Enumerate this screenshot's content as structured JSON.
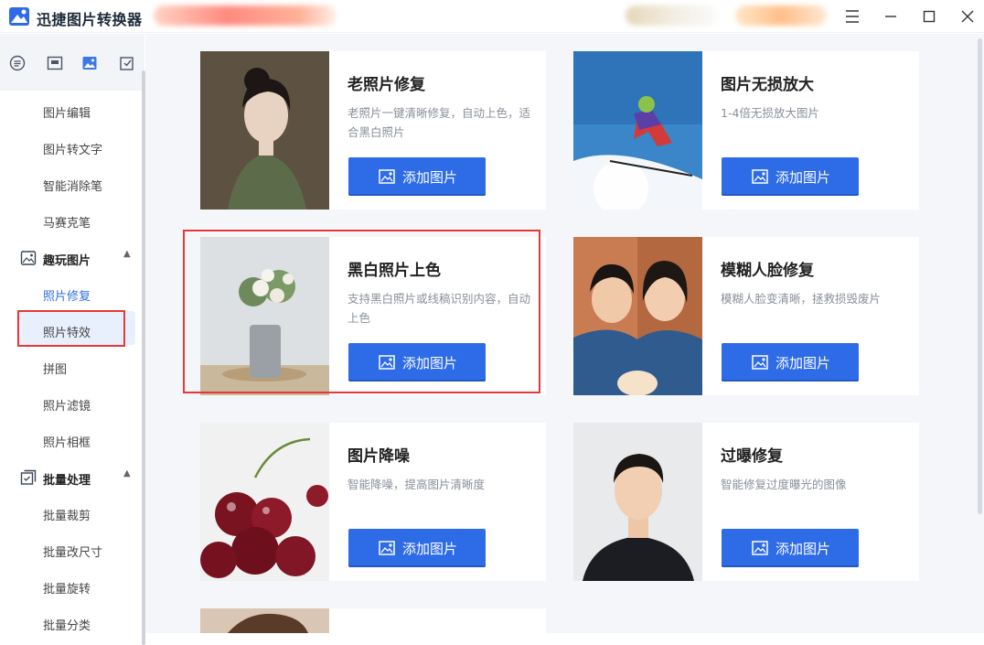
{
  "app": {
    "title": "迅捷图片转换器"
  },
  "sidebar": {
    "tool_icons": [
      "document-icon",
      "image-frame-icon",
      "picture-icon",
      "crop-icon"
    ],
    "items": [
      {
        "label": "图片编辑"
      },
      {
        "label": "图片转文字"
      },
      {
        "label": "智能消除笔"
      },
      {
        "label": "马赛克笔"
      }
    ],
    "group_fun": {
      "label": "趣玩图片",
      "icon": "image-fun-icon"
    },
    "fun_items": [
      {
        "label": "照片修复",
        "active": true
      },
      {
        "label": "照片特效"
      },
      {
        "label": "拼图"
      },
      {
        "label": "照片滤镜"
      },
      {
        "label": "照片相框"
      }
    ],
    "group_batch": {
      "label": "批量处理",
      "icon": "batch-icon"
    },
    "batch_items": [
      {
        "label": "批量裁剪"
      },
      {
        "label": "批量改尺寸"
      },
      {
        "label": "批量旋转"
      },
      {
        "label": "批量分类"
      }
    ]
  },
  "cards": [
    {
      "title": "老照片修复",
      "desc": "老照片一键清晰修复，自动上色，适合黑白照片",
      "button": "添加图片"
    },
    {
      "title": "图片无损放大",
      "desc": "1-4倍无损放大图片",
      "button": "添加图片"
    },
    {
      "title": "黑白照片上色",
      "desc": "支持黑白照片或线稿识别内容，自动上色",
      "button": "添加图片"
    },
    {
      "title": "模糊人脸修复",
      "desc": "模糊人脸变清晰，拯救损毁废片",
      "button": "添加图片"
    },
    {
      "title": "图片降噪",
      "desc": "智能降噪，提高图片清晰度",
      "button": "添加图片"
    },
    {
      "title": "过曝修复",
      "desc": "智能修复过度曝光的图像",
      "button": "添加图片"
    },
    {
      "title": "",
      "desc": "",
      "button": ""
    }
  ],
  "colors": {
    "accent": "#2e6be6",
    "highlight": "#e53935",
    "background": "#f4f6fa"
  }
}
